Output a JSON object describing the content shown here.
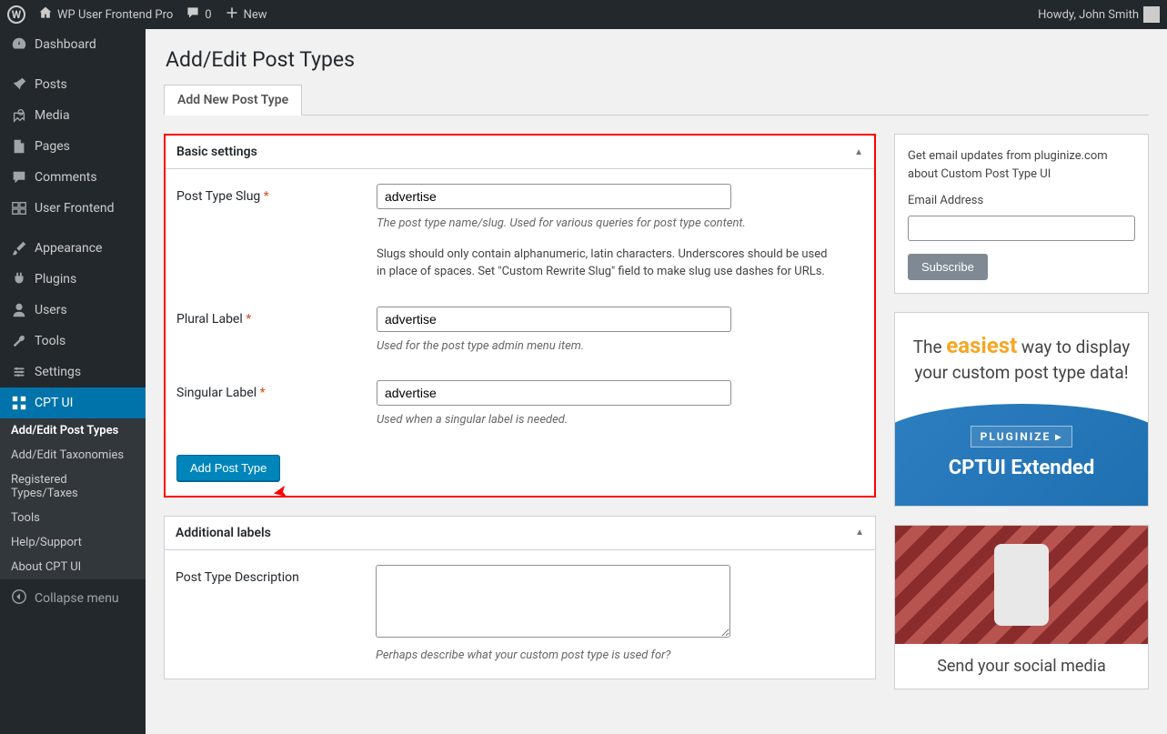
{
  "adminbar": {
    "site_name": "WP User Frontend Pro",
    "comments_count": "0",
    "new_label": "New",
    "greeting": "Howdy, John Smith"
  },
  "sidebar": {
    "items": [
      {
        "label": "Dashboard"
      },
      {
        "label": "Posts"
      },
      {
        "label": "Media"
      },
      {
        "label": "Pages"
      },
      {
        "label": "Comments"
      },
      {
        "label": "User Frontend"
      },
      {
        "label": "Appearance"
      },
      {
        "label": "Plugins"
      },
      {
        "label": "Users"
      },
      {
        "label": "Tools"
      },
      {
        "label": "Settings"
      },
      {
        "label": "CPT UI"
      }
    ],
    "submenu": [
      {
        "label": "Add/Edit Post Types",
        "current": true
      },
      {
        "label": "Add/Edit Taxonomies"
      },
      {
        "label": "Registered Types/Taxes"
      },
      {
        "label": "Tools"
      },
      {
        "label": "Help/Support"
      },
      {
        "label": "About CPT UI"
      }
    ],
    "collapse": "Collapse menu"
  },
  "page": {
    "title": "Add/Edit Post Types",
    "tab": "Add New Post Type"
  },
  "basic": {
    "heading": "Basic settings",
    "slug_label": "Post Type Slug",
    "slug_value": "advertise",
    "slug_desc": "The post type name/slug. Used for various queries for post type content.",
    "slug_desc2": "Slugs should only contain alphanumeric, latin characters. Underscores should be used in place of spaces. Set \"Custom Rewrite Slug\" field to make slug use dashes for URLs.",
    "plural_label": "Plural Label",
    "plural_value": "advertise",
    "plural_desc": "Used for the post type admin menu item.",
    "singular_label": "Singular Label",
    "singular_value": "advertise",
    "singular_desc": "Used when a singular label is needed.",
    "submit": "Add Post Type"
  },
  "additional": {
    "heading": "Additional labels",
    "desc_label": "Post Type Description",
    "desc_value": "",
    "desc_help": "Perhaps describe what your custom post type is used for?"
  },
  "newsletter": {
    "intro": "Get email updates from pluginize.com about Custom Post Type UI",
    "email_label": "Email Address",
    "subscribe": "Subscribe"
  },
  "promo": {
    "line1_pre": "The ",
    "line1_hl": "easiest",
    "line1_post": " way to display your custom post type data!",
    "brand": "PLUGINIZE",
    "product": "CPTUI Extended"
  },
  "promo2": {
    "text": "Send your social media"
  }
}
